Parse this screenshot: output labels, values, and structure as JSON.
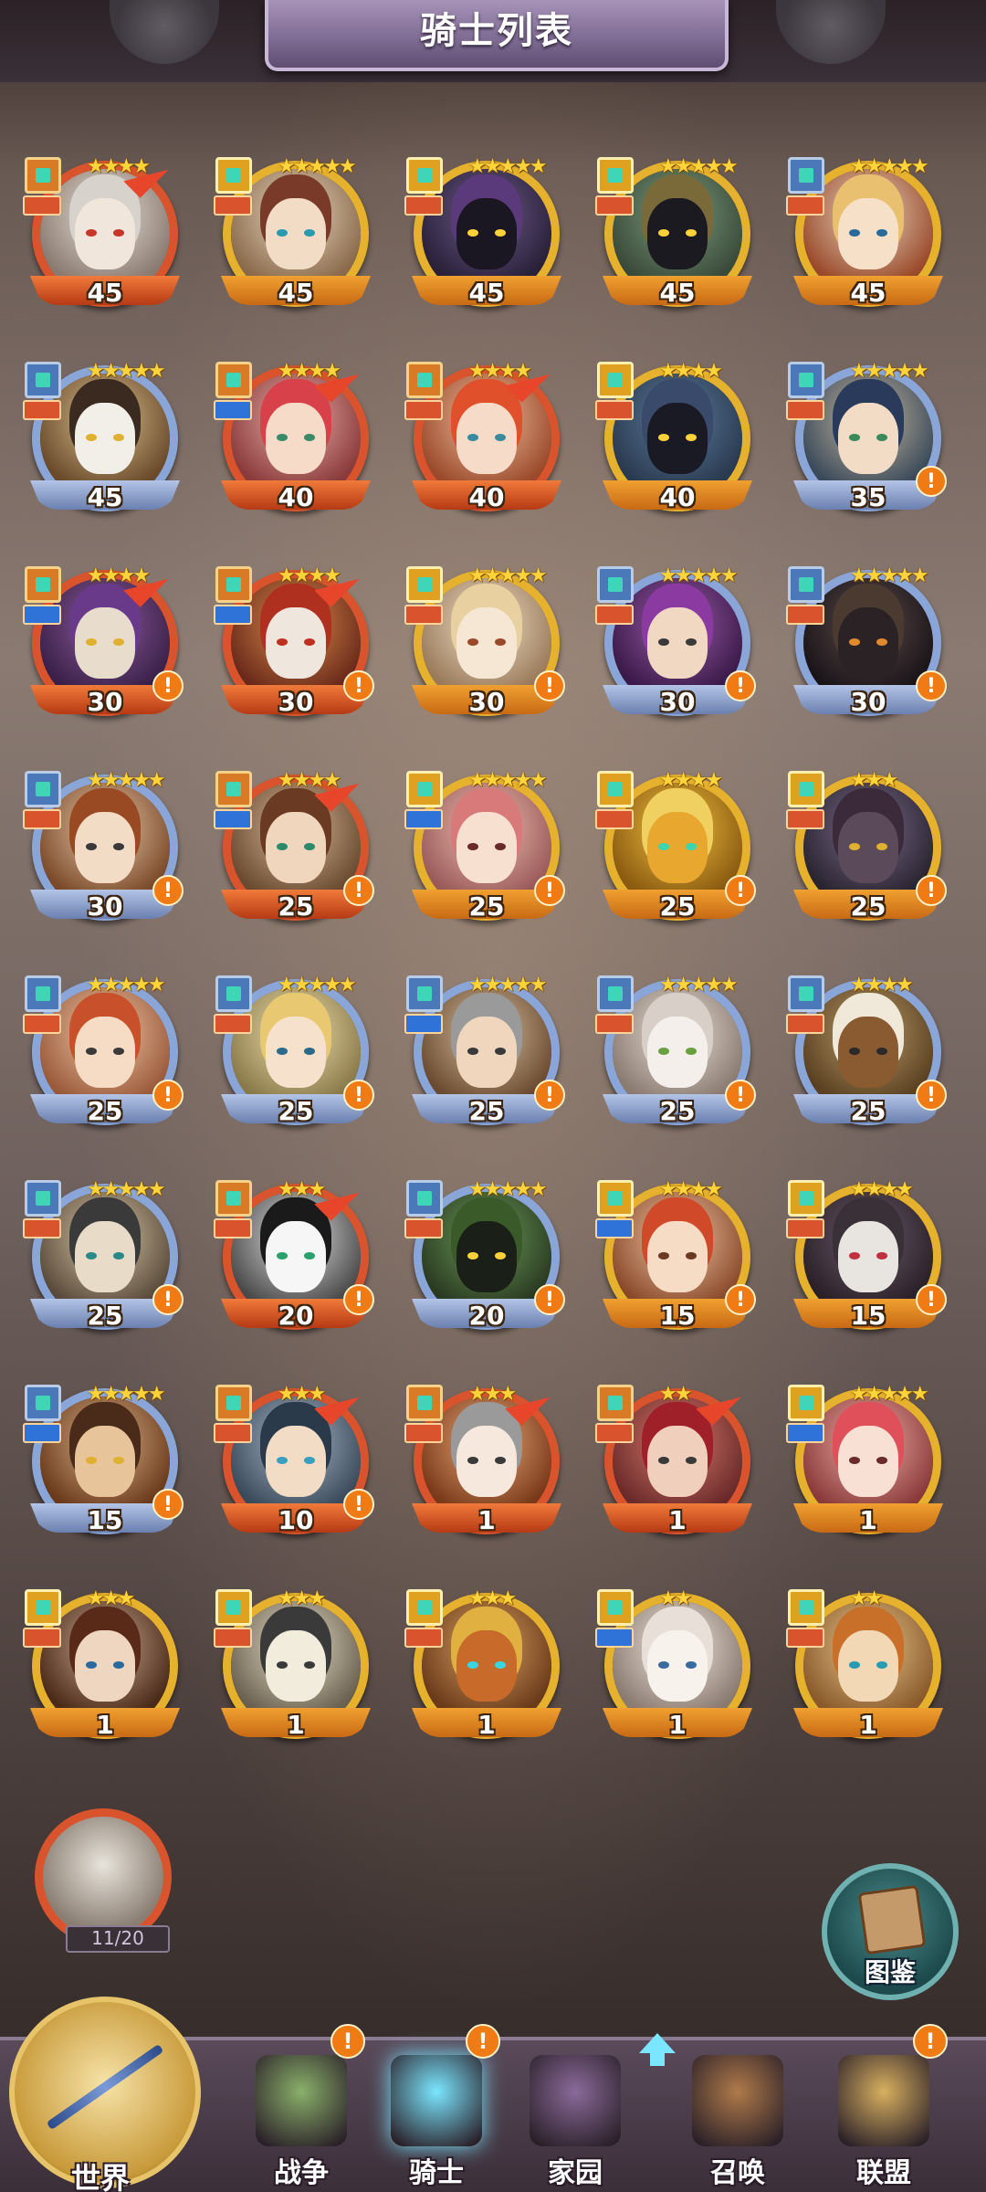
{
  "header": {
    "title": "骑士列表"
  },
  "knights": [
    {
      "level": "45",
      "stars": "★★★★",
      "frame": "red",
      "type": "red",
      "role": "red",
      "alert": false,
      "arrow": true,
      "c1": "#e6e0d8",
      "c2": "#8a7a70",
      "skin": "#f0e6dc",
      "hair": "#d8d2cc",
      "eye": "#c8362a"
    },
    {
      "level": "45",
      "stars": "★★★★★",
      "frame": "gold",
      "type": "gold",
      "role": "red",
      "alert": false,
      "arrow": false,
      "c1": "#e8d6c2",
      "c2": "#8a6a4a",
      "skin": "#f2dcc6",
      "hair": "#7a3a2a",
      "eye": "#2a9ab0"
    },
    {
      "level": "45",
      "stars": "★★★★★",
      "frame": "gold",
      "type": "gold",
      "role": "red",
      "alert": false,
      "arrow": false,
      "c1": "#6a5a8a",
      "c2": "#2a2038",
      "skin": "#1a1622",
      "hair": "#5a3a7a",
      "eye": "#ffd23a"
    },
    {
      "level": "45",
      "stars": "★★★★★",
      "frame": "gold",
      "type": "gold",
      "role": "red",
      "alert": false,
      "arrow": false,
      "c1": "#7a9a7a",
      "c2": "#3a4a3a",
      "skin": "#1a1a20",
      "hair": "#7a6a3a",
      "eye": "#ffd23a"
    },
    {
      "level": "45",
      "stars": "★★★★★",
      "frame": "gold",
      "type": "silver",
      "role": "red",
      "alert": false,
      "arrow": false,
      "c1": "#e8d6c2",
      "c2": "#9a4a2a",
      "skin": "#f6e0c8",
      "hair": "#e8c070",
      "eye": "#2a6a9a"
    },
    {
      "level": "45",
      "stars": "★★★★★",
      "frame": "silver",
      "type": "silver",
      "role": "red",
      "alert": false,
      "arrow": false,
      "c1": "#d8c090",
      "c2": "#6a4a2a",
      "skin": "#f2efe8",
      "hair": "#3a2a20",
      "eye": "#e0b030"
    },
    {
      "level": "40",
      "stars": "★★★★",
      "frame": "red",
      "type": "red",
      "role": "blue",
      "alert": false,
      "arrow": true,
      "c1": "#e8b0a8",
      "c2": "#8a3a3a",
      "skin": "#f6dcc8",
      "hair": "#d8404a",
      "eye": "#3a8a6a"
    },
    {
      "level": "40",
      "stars": "★★★★",
      "frame": "red",
      "type": "red",
      "role": "red",
      "alert": false,
      "arrow": true,
      "c1": "#f0c0a0",
      "c2": "#9a4a2a",
      "skin": "#f6dcc8",
      "hair": "#e0502a",
      "eye": "#3a8aa0"
    },
    {
      "level": "40",
      "stars": "★★★★",
      "frame": "gold",
      "type": "gold",
      "role": "red",
      "alert": false,
      "arrow": false,
      "c1": "#5a7a9a",
      "c2": "#2a3a50",
      "skin": "#1a1a24",
      "hair": "#3a4a6a",
      "eye": "#ffd23a"
    },
    {
      "level": "35",
      "stars": "★★★★★",
      "frame": "silver",
      "type": "silver",
      "role": "red",
      "alert": true,
      "arrow": false,
      "c1": "#c8b8a0",
      "c2": "#3a4a5a",
      "skin": "#f2dcc6",
      "hair": "#2a3a5a",
      "eye": "#3a8a5a"
    },
    {
      "level": "30",
      "stars": "★★★★",
      "frame": "red",
      "type": "red",
      "role": "blue",
      "alert": true,
      "arrow": true,
      "c1": "#8a5a9a",
      "c2": "#3a2048",
      "skin": "#e8dccc",
      "hair": "#6a3a8a",
      "eye": "#e0b030"
    },
    {
      "level": "30",
      "stars": "★★★★",
      "frame": "red",
      "type": "red",
      "role": "blue",
      "alert": true,
      "arrow": true,
      "c1": "#d88a4a",
      "c2": "#6a2a1a",
      "skin": "#efe6de",
      "hair": "#b03020",
      "eye": "#c03020"
    },
    {
      "level": "30",
      "stars": "★★★★★",
      "frame": "gold",
      "type": "gold",
      "role": "red",
      "alert": true,
      "arrow": false,
      "c1": "#f0e0c8",
      "c2": "#9a7a5a",
      "skin": "#f6e6d4",
      "hair": "#e8d0a0",
      "eye": "#9a4a2a"
    },
    {
      "level": "30",
      "stars": "★★★★★",
      "frame": "silver",
      "type": "silver",
      "role": "red",
      "alert": true,
      "arrow": false,
      "c1": "#9a5aa8",
      "c2": "#3a1a48",
      "skin": "#f0d8c2",
      "hair": "#8a3aa0",
      "eye": "#3a3a3a"
    },
    {
      "level": "30",
      "stars": "★★★★★",
      "frame": "silver",
      "type": "silver",
      "role": "red",
      "alert": true,
      "arrow": false,
      "c1": "#5a4a4a",
      "c2": "#1a1418",
      "skin": "#2a2224",
      "hair": "#4a3a30",
      "eye": "#e08a30"
    },
    {
      "level": "30",
      "stars": "★★★★★",
      "frame": "silver",
      "type": "silver",
      "role": "red",
      "alert": true,
      "arrow": false,
      "c1": "#e8c8a8",
      "c2": "#7a4a2a",
      "skin": "#f2dcc6",
      "hair": "#9a4a22",
      "eye": "#3a3a3a"
    },
    {
      "level": "25",
      "stars": "★★★★",
      "frame": "red",
      "type": "red",
      "role": "blue",
      "alert": true,
      "arrow": true,
      "c1": "#d8b898",
      "c2": "#6a4a30",
      "skin": "#f0d6bc",
      "hair": "#6a3a22",
      "eye": "#2a8a6a"
    },
    {
      "level": "25",
      "stars": "★★★★★",
      "frame": "gold",
      "type": "gold",
      "role": "blue",
      "alert": true,
      "arrow": false,
      "c1": "#f0c0b0",
      "c2": "#9a5a5a",
      "skin": "#f8e0d0",
      "hair": "#d87a7a",
      "eye": "#6a2a2a"
    },
    {
      "level": "25",
      "stars": "★★★★",
      "frame": "gold",
      "type": "gold",
      "role": "red",
      "alert": true,
      "arrow": false,
      "c1": "#f0c040",
      "c2": "#8a5a10",
      "skin": "#e8a830",
      "hair": "#f0d060",
      "eye": "#3ad6b0"
    },
    {
      "level": "25",
      "stars": "★★★",
      "frame": "gold",
      "type": "gold",
      "role": "red",
      "alert": true,
      "arrow": false,
      "c1": "#7a6a8a",
      "c2": "#2a2430",
      "skin": "#5a4a5a",
      "hair": "#3a2a3a",
      "eye": "#e0b030"
    },
    {
      "level": "25",
      "stars": "★★★★★",
      "frame": "silver",
      "type": "silver",
      "role": "red",
      "alert": true,
      "arrow": false,
      "c1": "#f0c8a8",
      "c2": "#9a5a3a",
      "skin": "#f6dcc4",
      "hair": "#c8502a",
      "eye": "#3a3a3a"
    },
    {
      "level": "25",
      "stars": "★★★★★",
      "frame": "silver",
      "type": "silver",
      "role": "red",
      "alert": true,
      "arrow": false,
      "c1": "#f0e0b0",
      "c2": "#8a7a4a",
      "skin": "#f6e2cc",
      "hair": "#e8c870",
      "eye": "#2a6a8a"
    },
    {
      "level": "25",
      "stars": "★★★★★",
      "frame": "silver",
      "type": "silver",
      "role": "blue",
      "alert": true,
      "arrow": false,
      "c1": "#d8c0a0",
      "c2": "#6a4a30",
      "skin": "#f0d6bc",
      "hair": "#9a9a9a",
      "eye": "#3a3a3a"
    },
    {
      "level": "25",
      "stars": "★★★★★",
      "frame": "silver",
      "type": "silver",
      "role": "red",
      "alert": true,
      "arrow": false,
      "c1": "#e8e0d8",
      "c2": "#8a7a70",
      "skin": "#f4efea",
      "hair": "#d8d0c8",
      "eye": "#6aa040"
    },
    {
      "level": "25",
      "stars": "★★★★",
      "frame": "silver",
      "type": "silver",
      "role": "red",
      "alert": true,
      "arrow": false,
      "c1": "#b89a6a",
      "c2": "#5a4020",
      "skin": "#8a5a30",
      "hair": "#f0e8d8",
      "eye": "#2a2a2a"
    },
    {
      "level": "25",
      "stars": "★★★★★",
      "frame": "silver",
      "type": "silver",
      "role": "red",
      "alert": true,
      "arrow": false,
      "c1": "#d8c8a8",
      "c2": "#5a4a3a",
      "skin": "#e8dcc8",
      "hair": "#3a3a3a",
      "eye": "#2a8a8a"
    },
    {
      "level": "20",
      "stars": "★★★",
      "frame": "red",
      "type": "red",
      "role": "red",
      "alert": true,
      "arrow": true,
      "c1": "#e0e0e0",
      "c2": "#4a4a4a",
      "skin": "#f6f6f6",
      "hair": "#1a1a1a",
      "eye": "#2aa06a"
    },
    {
      "level": "20",
      "stars": "★★★★★",
      "frame": "silver",
      "type": "silver",
      "role": "red",
      "alert": true,
      "arrow": false,
      "c1": "#6a9a5a",
      "c2": "#2a3a20",
      "skin": "#1a2018",
      "hair": "#3a5a2a",
      "eye": "#ffd23a"
    },
    {
      "level": "15",
      "stars": "★★★★",
      "frame": "gold",
      "type": "gold",
      "role": "blue",
      "alert": true,
      "arrow": false,
      "c1": "#f0c8a8",
      "c2": "#8a4a2a",
      "skin": "#f6dcc4",
      "hair": "#d04a2a",
      "eye": "#6a3a22"
    },
    {
      "level": "15",
      "stars": "★★★★",
      "frame": "gold",
      "type": "gold",
      "role": "red",
      "alert": true,
      "arrow": false,
      "c1": "#6a5a6a",
      "c2": "#2a2028",
      "skin": "#e8e4e0",
      "hair": "#3a3038",
      "eye": "#c03040"
    },
    {
      "level": "15",
      "stars": "★★★★★",
      "frame": "silver",
      "type": "silver",
      "role": "blue",
      "alert": true,
      "arrow": false,
      "c1": "#d8b08a",
      "c2": "#6a3a1a",
      "skin": "#e8c49a",
      "hair": "#4a2a18",
      "eye": "#e0b030"
    },
    {
      "level": "10",
      "stars": "★★★",
      "frame": "red",
      "type": "red",
      "role": "red",
      "alert": true,
      "arrow": true,
      "c1": "#a8b8c8",
      "c2": "#3a4a5a",
      "skin": "#f2dcc6",
      "hair": "#2a3a4a",
      "eye": "#3aa0c0"
    },
    {
      "level": "1",
      "stars": "★★★",
      "frame": "red",
      "type": "red",
      "role": "red",
      "alert": false,
      "arrow": true,
      "c1": "#e8a878",
      "c2": "#7a3a1a",
      "skin": "#f6e8dc",
      "hair": "#9a9a9a",
      "eye": "#3a3a3a"
    },
    {
      "level": "1",
      "stars": "★★",
      "frame": "red",
      "type": "red",
      "role": "red",
      "alert": false,
      "arrow": true,
      "c1": "#d87a6a",
      "c2": "#6a2a2a",
      "skin": "#f0d0bc",
      "hair": "#a0202a",
      "eye": "#3a3a3a"
    },
    {
      "level": "1",
      "stars": "★★★★★",
      "frame": "gold",
      "type": "gold",
      "role": "blue",
      "alert": false,
      "arrow": false,
      "c1": "#f0b0a8",
      "c2": "#8a3a3a",
      "skin": "#f8e0d4",
      "hair": "#e0505a",
      "eye": "#6a2a2a"
    },
    {
      "level": "1",
      "stars": "★★★",
      "frame": "gold",
      "type": "gold",
      "role": "red",
      "alert": false,
      "arrow": false,
      "c1": "#c8a890",
      "c2": "#4a2a18",
      "skin": "#eed6c0",
      "hair": "#5a2a18",
      "eye": "#2a6aa0"
    },
    {
      "level": "1",
      "stars": "★★★",
      "frame": "gold",
      "type": "gold",
      "role": "red",
      "alert": false,
      "arrow": false,
      "c1": "#e8e0c8",
      "c2": "#6a6050",
      "skin": "#f2ecdc",
      "hair": "#3a3a3a",
      "eye": "#3a3a3a"
    },
    {
      "level": "1",
      "stars": "★★★",
      "frame": "gold",
      "type": "gold",
      "role": "red",
      "alert": false,
      "arrow": false,
      "c1": "#d8a060",
      "c2": "#6a3a1a",
      "skin": "#c86a2a",
      "hair": "#e0b040",
      "eye": "#3ad6e0"
    },
    {
      "level": "1",
      "stars": "★★",
      "frame": "gold",
      "type": "gold",
      "role": "blue",
      "alert": false,
      "arrow": false,
      "c1": "#f0e8e0",
      "c2": "#8a7a70",
      "skin": "#f8f2ec",
      "hair": "#e8e0d8",
      "eye": "#3a6aa0"
    },
    {
      "level": "1",
      "stars": "★★",
      "frame": "gold",
      "type": "gold",
      "role": "red",
      "alert": false,
      "arrow": false,
      "c1": "#e8c890",
      "c2": "#8a5a2a",
      "skin": "#f2d8b4",
      "hair": "#c8702a",
      "eye": "#2a9ab0"
    }
  ],
  "extra_knight": {
    "count": "11/20"
  },
  "collection_button": {
    "label": "图鉴"
  },
  "nav": {
    "world": "世界",
    "items": [
      {
        "label": "战争",
        "badge": "!",
        "icon_color": "#8ab06a",
        "icon": "map-icon"
      },
      {
        "label": "骑士",
        "badge": "!",
        "icon_color": "#7ae6ff",
        "icon": "knight-icon",
        "active": true
      },
      {
        "label": "家园",
        "badge": "",
        "icon_color": "#8a6a9a",
        "icon": "house-icon"
      },
      {
        "label": "召唤",
        "badge": "",
        "icon_color": "#b07a4a",
        "icon": "train-icon"
      },
      {
        "label": "联盟",
        "badge": "!",
        "icon_color": "#d8b060",
        "icon": "alliance-icon"
      }
    ]
  },
  "alert_symbol": "!"
}
